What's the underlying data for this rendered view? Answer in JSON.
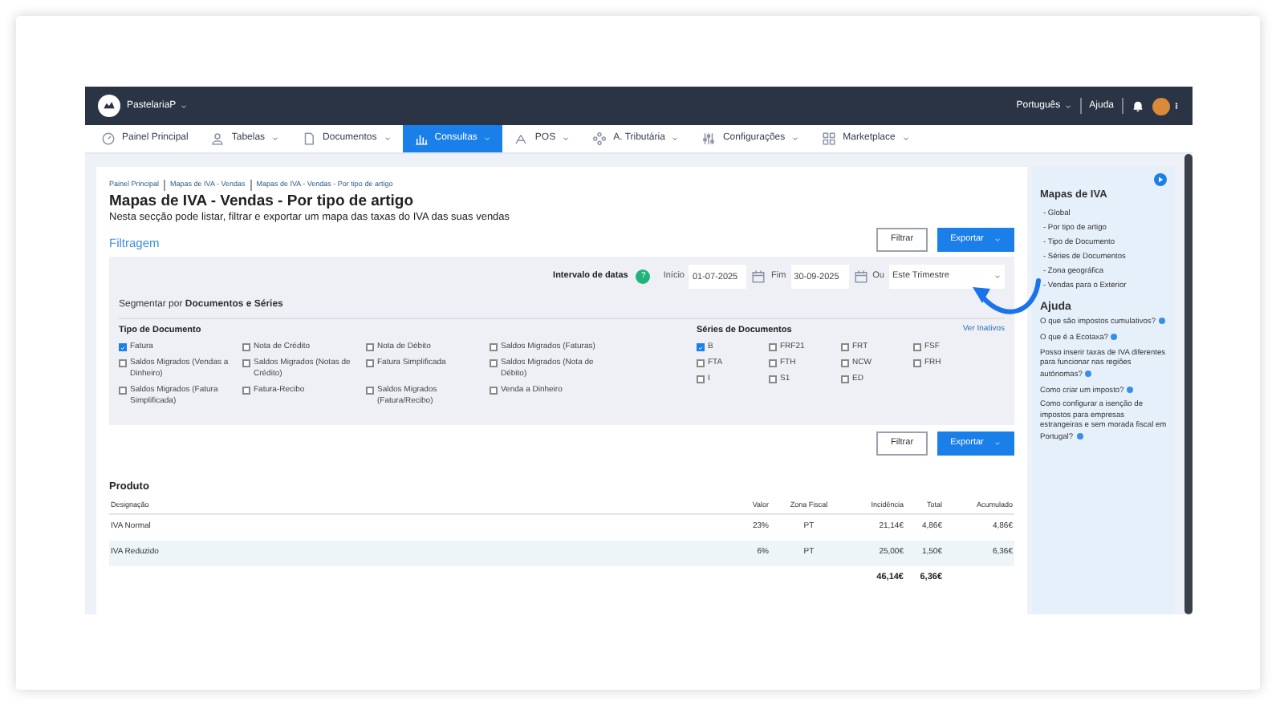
{
  "topbar": {
    "company": "PastelariaP",
    "language": "Português",
    "help": "Ajuda"
  },
  "nav": [
    {
      "label": "Painel Principal",
      "kind": "gauge",
      "selected": false,
      "caret": false
    },
    {
      "label": "Tabelas",
      "kind": "users",
      "selected": false,
      "caret": true
    },
    {
      "label": "Documentos",
      "kind": "document",
      "selected": false,
      "caret": true
    },
    {
      "label": "Consultas",
      "kind": "chart",
      "selected": true,
      "caret": true
    },
    {
      "label": "POS",
      "kind": "pos",
      "selected": false,
      "caret": true
    },
    {
      "label": "A. Tributária",
      "kind": "tax",
      "selected": false,
      "caret": true
    },
    {
      "label": "Configurações",
      "kind": "sliders",
      "selected": false,
      "caret": true
    },
    {
      "label": "Marketplace",
      "kind": "apps",
      "selected": false,
      "caret": true
    }
  ],
  "breadcrumb": [
    "Painel Principal",
    "Mapas de IVA - Vendas",
    "Mapas de IVA - Vendas - Por tipo de artigo"
  ],
  "title": "Mapas de IVA - Vendas - Por tipo de artigo",
  "subtitle": "Nesta secção pode listar, filtrar e exportar um mapa das taxas do IVA das suas vendas",
  "filter_heading": "Filtragem",
  "top_buttons": {
    "filter": "Filtrar",
    "export": "Exportar"
  },
  "date_range": {
    "label": "Intervalo de datas",
    "help": "?",
    "start_label": "Início",
    "start": "01-07-2025",
    "end_label": "Fim",
    "end": "30-09-2025",
    "or": "Ou",
    "preset": "Este Trimestre"
  },
  "segment": "Segmentar por **Documentos e Séries**",
  "document_types": {
    "heading": "Tipo de Documento",
    "items": [
      {
        "label": "Fatura",
        "checked": true
      },
      {
        "label": "Nota de Crédito",
        "checked": false
      },
      {
        "label": "Nota de Débito",
        "checked": false
      },
      {
        "label": "Saldos Migrados (Faturas)",
        "checked": false
      },
      {
        "label": "Saldos Migrados (Vendas a Dinheiro)",
        "checked": false
      },
      {
        "label": "Saldos Migrados (Notas de Crédito)",
        "checked": false
      },
      {
        "label": "Fatura Simplificada",
        "checked": false
      },
      {
        "label": "Saldos Migrados (Nota de Débito)",
        "checked": false
      },
      {
        "label": "Saldos Migrados (Fatura Simplificada)",
        "checked": false
      },
      {
        "label": "Fatura-Recibo",
        "checked": false
      },
      {
        "label": "Saldos Migrados (Fatura/Recibo)",
        "checked": false
      },
      {
        "label": "Venda a Dinheiro",
        "checked": false
      }
    ]
  },
  "series": {
    "heading": "Séries de Documentos",
    "link": "Ver Inativos",
    "items": [
      {
        "label": "B",
        "checked": true
      },
      {
        "label": "FRF21",
        "checked": false
      },
      {
        "label": "FRT",
        "checked": false
      },
      {
        "label": "FSF",
        "checked": false
      },
      {
        "label": "FTA",
        "checked": false
      },
      {
        "label": "FTH",
        "checked": false
      },
      {
        "label": "NCW",
        "checked": false
      },
      {
        "label": "FRH",
        "checked": false
      },
      {
        "label": "I",
        "checked": false
      },
      {
        "label": "S1",
        "checked": false
      },
      {
        "label": "ED",
        "checked": false
      }
    ]
  },
  "bottom_buttons": {
    "filter": "Filtrar",
    "export": "Exportar"
  },
  "table": {
    "heading": "Produto",
    "columns": [
      "Designação",
      "Valor",
      "Zona Fiscal",
      "Incidência",
      "Total",
      "Acumulado"
    ],
    "rows": [
      [
        "IVA Normal",
        "23%",
        "PT",
        "21,14€",
        "4,86€",
        "4,86€"
      ],
      [
        "IVA Reduzido",
        "6%",
        "PT",
        "25,00€",
        "1,50€",
        "6,36€"
      ]
    ],
    "totals": {
      "incidence": "46,14€",
      "total": "6,36€"
    }
  },
  "sidebar": {
    "heading": "Mapas de IVA",
    "links": [
      "- Global",
      "- Por tipo de artigo",
      "- Tipo de Documento",
      "- Séries de Documentos",
      "- Zona geográfica",
      "- Vendas para o Exterior"
    ],
    "help_heading": "Ajuda",
    "help_links": [
      "O que são impostos cumulativos?",
      "O que é a Ecotaxa?",
      "Posso inserir taxas de IVA diferentes para funcionar nas regiões autónomas?",
      "Como criar um imposto?",
      "Como configurar a isenção de impostos para empresas estrangeiras e sem morada fiscal em Portugal?"
    ]
  }
}
